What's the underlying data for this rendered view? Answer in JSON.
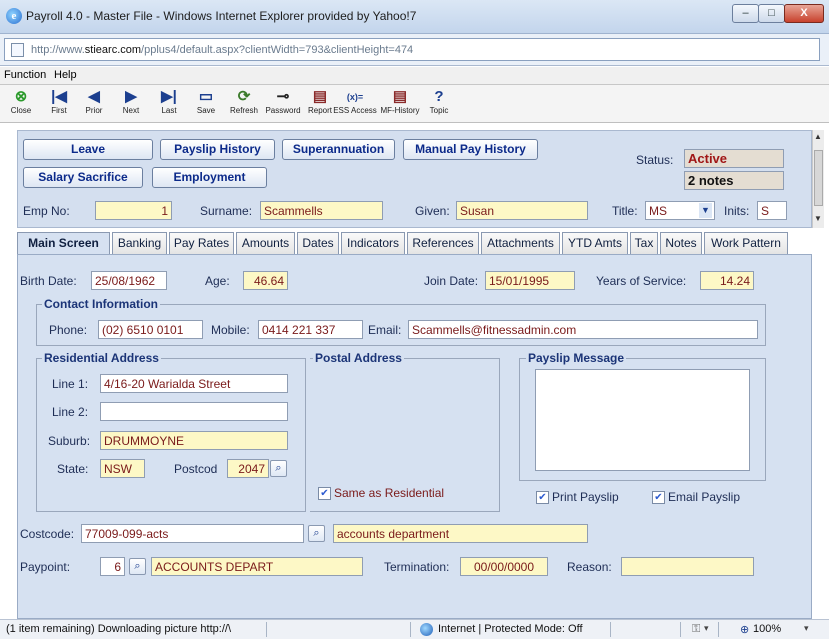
{
  "window": {
    "title": "Payroll 4.0 - Master File - Windows Internet Explorer provided by Yahoo!7",
    "min": "–",
    "max": "□",
    "close": "X",
    "ie_glyph": "e"
  },
  "address": {
    "prefix": "http://www.",
    "domain": "stiearc.com",
    "path": "/pplus4/default.aspx?clientWidth=793&clientHeight=474"
  },
  "menu": {
    "items": [
      "Function",
      "Help"
    ]
  },
  "toolbar": {
    "buttons": [
      {
        "label": "Close",
        "icon": "close-circle-icon",
        "glyph": "⊗"
      },
      {
        "label": "First",
        "icon": "first-record-icon",
        "glyph": "|◀"
      },
      {
        "label": "Prior",
        "icon": "prior-record-icon",
        "glyph": "◀"
      },
      {
        "label": "Next",
        "icon": "next-record-icon",
        "glyph": "▶"
      },
      {
        "label": "Last",
        "icon": "last-record-icon",
        "glyph": "▶|"
      },
      {
        "label": "Save",
        "icon": "save-disk-icon",
        "glyph": "▭"
      },
      {
        "label": "Refresh",
        "icon": "refresh-icon",
        "glyph": "⟳"
      },
      {
        "label": "Password",
        "icon": "key-icon",
        "glyph": "⊸"
      },
      {
        "label": "Report",
        "icon": "report-icon",
        "glyph": "▤"
      },
      {
        "label": "ESS Access",
        "icon": "formula-icon",
        "glyph": "(x)="
      },
      {
        "label": "MF-History",
        "icon": "history-icon",
        "glyph": "▤"
      },
      {
        "label": "Topic",
        "icon": "help-icon",
        "glyph": "?"
      }
    ]
  },
  "header": {
    "buttons": {
      "leave": "Leave",
      "payslip_history": "Payslip History",
      "superannuation": "Superannuation",
      "manual_pay_history": "Manual Pay History",
      "salary_sacrifice": "Salary Sacrifice",
      "employment": "Employment"
    },
    "status_label": "Status:",
    "status_value": "Active",
    "notes_value": "2 notes",
    "emp_no_label": "Emp No:",
    "emp_no": "1",
    "surname_label": "Surname:",
    "surname": "Scammells",
    "given_label": "Given:",
    "given": "Susan",
    "title_label": "Title:",
    "title_value": "MS",
    "inits_label": "Inits:",
    "inits": "S"
  },
  "tabs": [
    "Main Screen",
    "Banking",
    "Pay Rates",
    "Amounts",
    "Dates",
    "Indicators",
    "References",
    "Attachments",
    "YTD Amts",
    "Tax",
    "Notes",
    "Work Pattern"
  ],
  "main": {
    "birth_date_label": "Birth Date:",
    "birth_date": "25/08/1962",
    "age_label": "Age:",
    "age": "46.64",
    "join_date_label": "Join Date:",
    "join_date": "15/01/1995",
    "years_service_label": "Years of Service:",
    "years_service": "14.24",
    "contact_title": "Contact Information",
    "phone_label": "Phone:",
    "phone": "(02) 6510 0101",
    "mobile_label": "Mobile:",
    "mobile": "0414 221 337",
    "email_label": "Email:",
    "email": "Scammells@fitnessadmin.com",
    "residential_title": "Residential Address",
    "line1_label": "Line 1:",
    "line1": "4/16-20 Warialda Street",
    "line2_label": "Line 2:",
    "line2": "",
    "suburb_label": "Suburb:",
    "suburb": "DRUMMOYNE",
    "state_label": "State:",
    "state": "NSW",
    "postcode_label": "Postcod",
    "postcode": "2047",
    "postal_title": "Postal Address",
    "same_as_residential": "Same as Residential",
    "payslip_message_title": "Payslip Message",
    "print_payslip": "Print Payslip",
    "email_payslip": "Email Payslip",
    "costcode_label": "Costcode:",
    "costcode": "77009-099-acts",
    "costcode_desc": "accounts department",
    "paypoint_label": "Paypoint:",
    "paypoint": "6",
    "paypoint_desc": "ACCOUNTS DEPART",
    "termination_label": "Termination:",
    "termination": "00/00/0000",
    "reason_label": "Reason:",
    "reason": ""
  },
  "status_bar": {
    "left": "(1 item remaining) Downloading picture http://\\",
    "zone": "Internet | Protected Mode: Off",
    "zoom": "100%",
    "zoom_glyph": "⊕",
    "lock_glyph": "⚿",
    "dropdown_glyph": "▾"
  }
}
